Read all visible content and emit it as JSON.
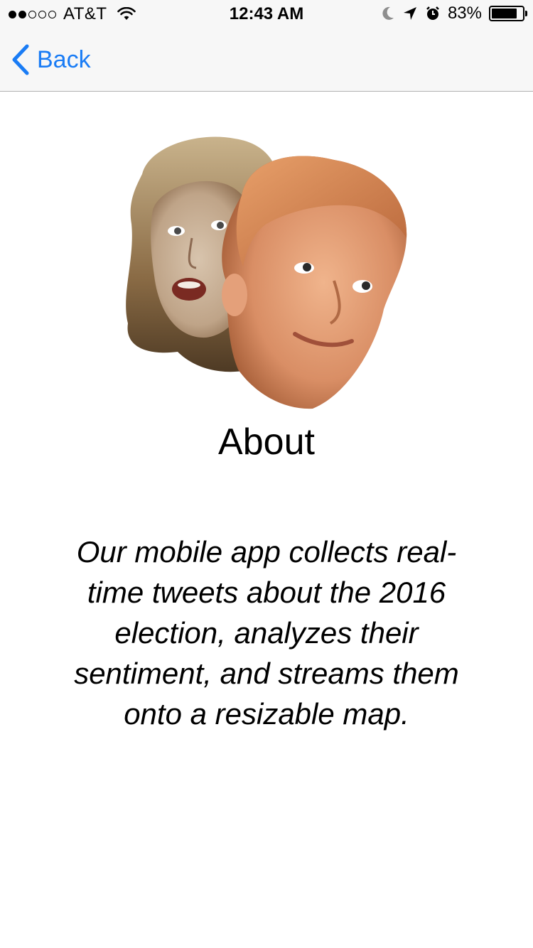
{
  "status_bar": {
    "carrier": "AT&T",
    "signal_bars_filled": 2,
    "signal_bars_total": 5,
    "time": "12:43 AM",
    "battery_percent": "83%",
    "battery_level": 0.83,
    "icons": [
      "wifi-icon",
      "moon-icon",
      "location-arrow-icon",
      "alarm-icon",
      "battery-icon"
    ]
  },
  "nav": {
    "back_label": "Back",
    "accent_color": "#1a7cf5"
  },
  "content": {
    "title": "About",
    "description": "Our mobile app collects real-time tweets about the 2016 election, analyzes their sentiment, and streams them onto a resizable map.",
    "hero_image": "two-candidate-faces-painting"
  }
}
